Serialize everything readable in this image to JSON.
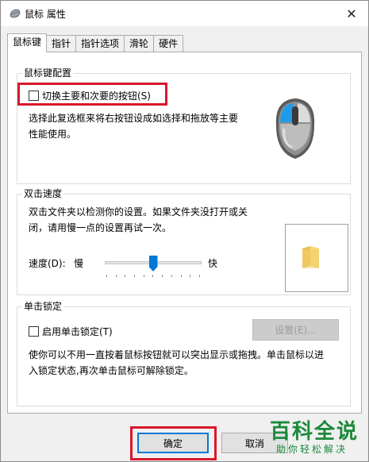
{
  "window": {
    "title": "鼠标 属性",
    "close_glyph": "✕"
  },
  "tabs": [
    {
      "label": "鼠标键",
      "active": true
    },
    {
      "label": "指针",
      "active": false
    },
    {
      "label": "指针选项",
      "active": false
    },
    {
      "label": "滑轮",
      "active": false
    },
    {
      "label": "硬件",
      "active": false
    }
  ],
  "button_config": {
    "title": "鼠标键配置",
    "switch_label": "切换主要和次要的按钮(S)",
    "switch_checked": false,
    "description_line1": "选择此复选框来将右按钮设成如选择和拖放等主要",
    "description_line2": "性能使用。"
  },
  "double_click": {
    "title": "双击速度",
    "description_line1": "双击文件夹以检测你的设置。如果文件夹没打开或关",
    "description_line2": "闭，请用慢一点的设置再试一次。",
    "speed_label": "速度(D):",
    "slow_label": "慢",
    "fast_label": "快",
    "speed_fraction": 0.5
  },
  "click_lock": {
    "title": "单击锁定",
    "enable_label": "启用单击锁定(T)",
    "enable_checked": false,
    "settings_label": "设置(E)...",
    "description_line1": "使你可以不用一直按着鼠标按钮就可以突出显示或拖拽。单击鼠标以进",
    "description_line2": "入锁定状态,再次单击鼠标可解除锁定。"
  },
  "footer": {
    "ok_label": "确定",
    "cancel_label": "取消"
  },
  "watermark": {
    "title": "百科全说",
    "subtitle": "助你轻松解决"
  },
  "colors": {
    "accent": "#0078d7",
    "highlight": "#d9182c",
    "watermark": "#1b8a3a"
  }
}
